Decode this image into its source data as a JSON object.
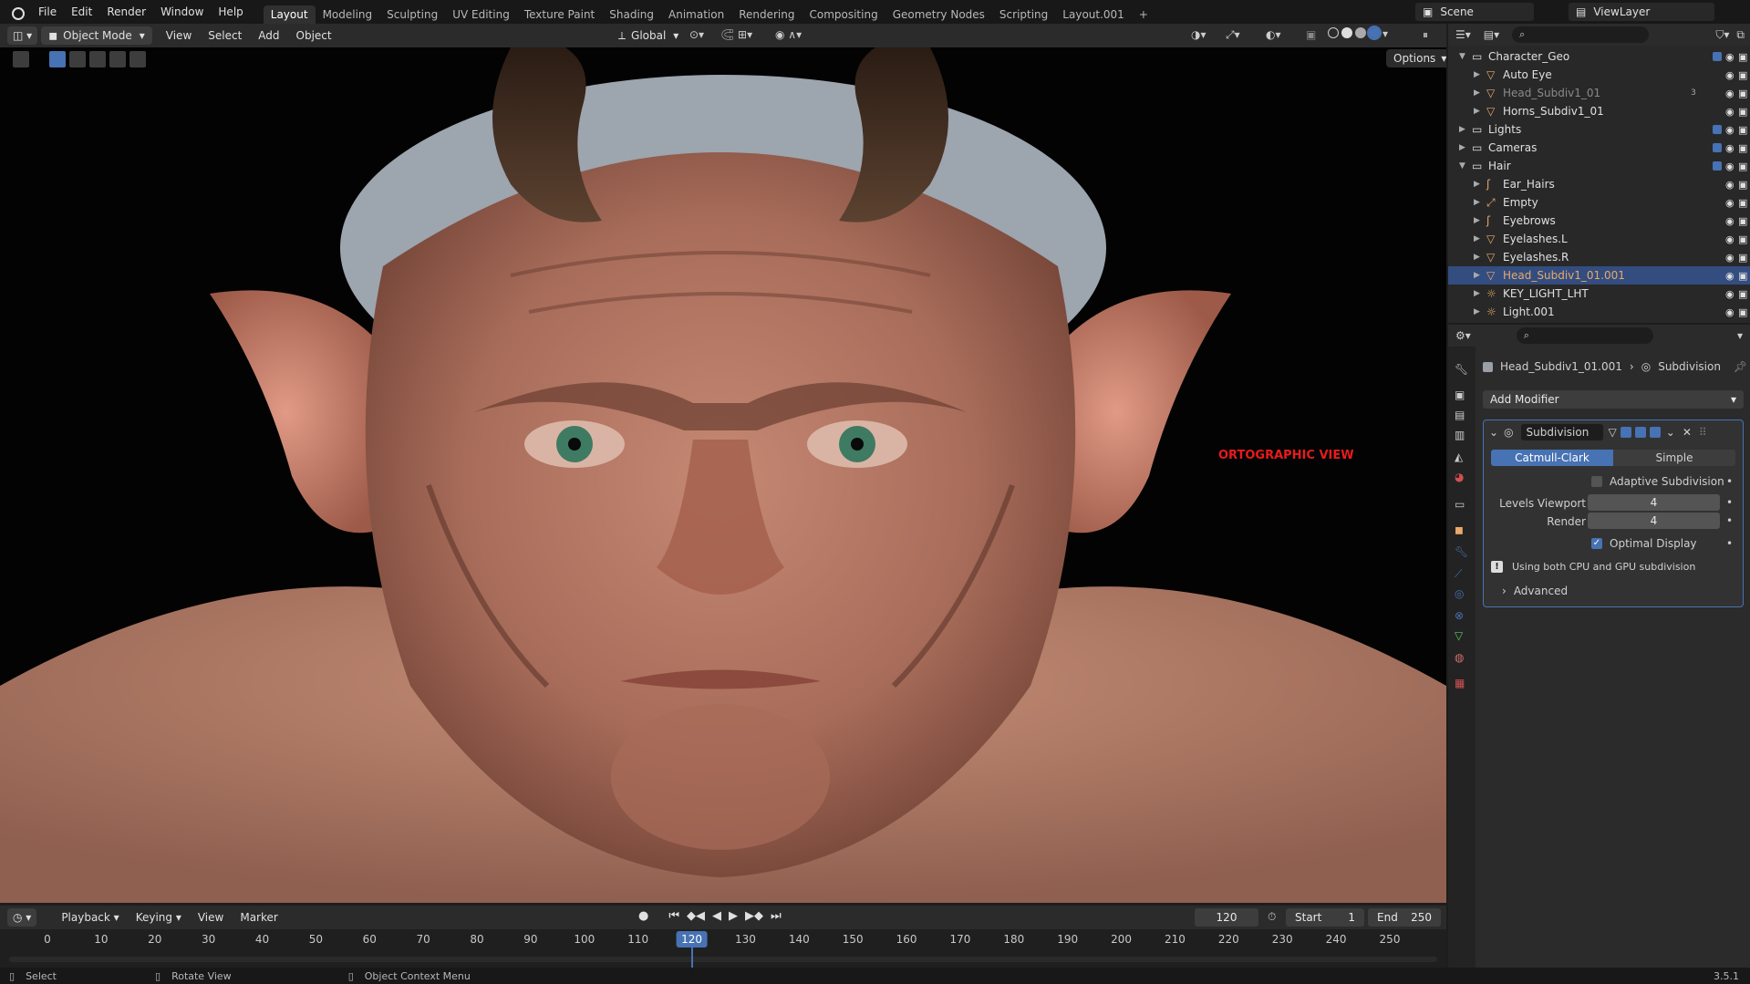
{
  "menu": [
    "File",
    "Edit",
    "Render",
    "Window",
    "Help"
  ],
  "workspaces": [
    "Layout",
    "Modeling",
    "Sculpting",
    "UV Editing",
    "Texture Paint",
    "Shading",
    "Animation",
    "Rendering",
    "Compositing",
    "Geometry Nodes",
    "Scripting",
    "Layout.001"
  ],
  "active_workspace": "Layout",
  "add_tab": "+",
  "scene_name": "Scene",
  "view_layer": "ViewLayer",
  "viewport_header": {
    "mode": "Object Mode",
    "menus": [
      "View",
      "Select",
      "Add",
      "Object"
    ],
    "transform_orientation": "Global",
    "options": "Options"
  },
  "viewport_label": "ORTOGRAPHIC VIEW",
  "outliner": {
    "rows": [
      {
        "name": "Character_Geo",
        "type": "collection",
        "indent": 0,
        "expanded": true
      },
      {
        "name": "Auto Eye",
        "type": "mesh",
        "indent": 1
      },
      {
        "name": "Head_Subdiv1_01",
        "type": "mesh",
        "indent": 1,
        "dimmed": true
      },
      {
        "name": "Horns_Subdiv1_01",
        "type": "mesh",
        "indent": 1
      },
      {
        "name": "Lights",
        "type": "collection",
        "indent": 0
      },
      {
        "name": "Cameras",
        "type": "collection",
        "indent": 0
      },
      {
        "name": "Hair",
        "type": "collection",
        "indent": 0,
        "expanded": true
      },
      {
        "name": "Ear_Hairs",
        "type": "curves",
        "indent": 1
      },
      {
        "name": "Empty",
        "type": "empty",
        "indent": 1
      },
      {
        "name": "Eyebrows",
        "type": "curves",
        "indent": 1
      },
      {
        "name": "Eyelashes.L",
        "type": "mesh",
        "indent": 1
      },
      {
        "name": "Eyelashes.R",
        "type": "mesh",
        "indent": 1
      },
      {
        "name": "Head_Subdiv1_01.001",
        "type": "mesh",
        "indent": 1,
        "selected": true
      },
      {
        "name": "KEY_LIGHT_LHT",
        "type": "light",
        "indent": 1
      },
      {
        "name": "Light.001",
        "type": "light",
        "indent": 1
      }
    ],
    "badge_count": "3"
  },
  "properties": {
    "object_name": "Head_Subdiv1_01.001",
    "modifier_crumb": "Subdivision",
    "add_modifier": "Add Modifier",
    "modifier_name": "Subdivision",
    "method_options": [
      "Catmull-Clark",
      "Simple"
    ],
    "method_selected": "Catmull-Clark",
    "adaptive_label": "Adaptive Subdivision",
    "levels_viewport_label": "Levels Viewport",
    "levels_viewport": "4",
    "render_label": "Render",
    "render_value": "4",
    "optimal_display_label": "Optimal Display",
    "info_text": "Using both CPU and GPU subdivision",
    "advanced_label": "Advanced"
  },
  "timeline": {
    "menus": [
      "Playback",
      "Keying",
      "View",
      "Marker"
    ],
    "current_frame": "120",
    "start_label": "Start",
    "start": "1",
    "end_label": "End",
    "end": "250",
    "ticks": [
      "0",
      "10",
      "20",
      "30",
      "40",
      "50",
      "60",
      "70",
      "80",
      "90",
      "100",
      "110",
      "120",
      "130",
      "140",
      "150",
      "160",
      "170",
      "180",
      "190",
      "200",
      "210",
      "220",
      "230",
      "240",
      "250"
    ]
  },
  "statusbar": {
    "select": "Select",
    "rotate": "Rotate View",
    "context": "Object Context Menu",
    "version": "3.5.1"
  },
  "colors": {
    "accent": "#4772b3",
    "selection": "#334d80",
    "label_red": "#e81b1b"
  }
}
